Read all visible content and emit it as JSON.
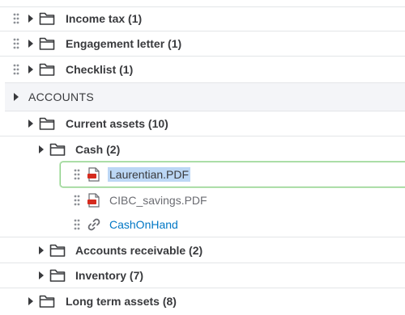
{
  "tree": {
    "rows": [
      {
        "label": "Income tax (1)"
      },
      {
        "label": "Engagement letter (1)"
      },
      {
        "label": "Checklist (1)"
      },
      {
        "label": "ACCOUNTS"
      },
      {
        "label": "Current assets (10)"
      },
      {
        "label": "Cash (2)"
      },
      {
        "label": "Laurentian.PDF"
      },
      {
        "label": "CIBC_savings.PDF"
      },
      {
        "label": "CashOnHand"
      },
      {
        "label": "Accounts receivable (2)"
      },
      {
        "label": "Inventory (7)"
      },
      {
        "label": "Long term assets (8)"
      }
    ]
  },
  "colors": {
    "link": "#0077c5",
    "pdf_red": "#d52b1e",
    "selection": "#bcd7f5",
    "focus_border": "#8fd08a"
  },
  "icons": {
    "drag": "drag-handle-icon",
    "expand": "caret-right-icon",
    "folder": "folder-icon",
    "pdf": "pdf-file-icon",
    "link": "link-icon"
  }
}
